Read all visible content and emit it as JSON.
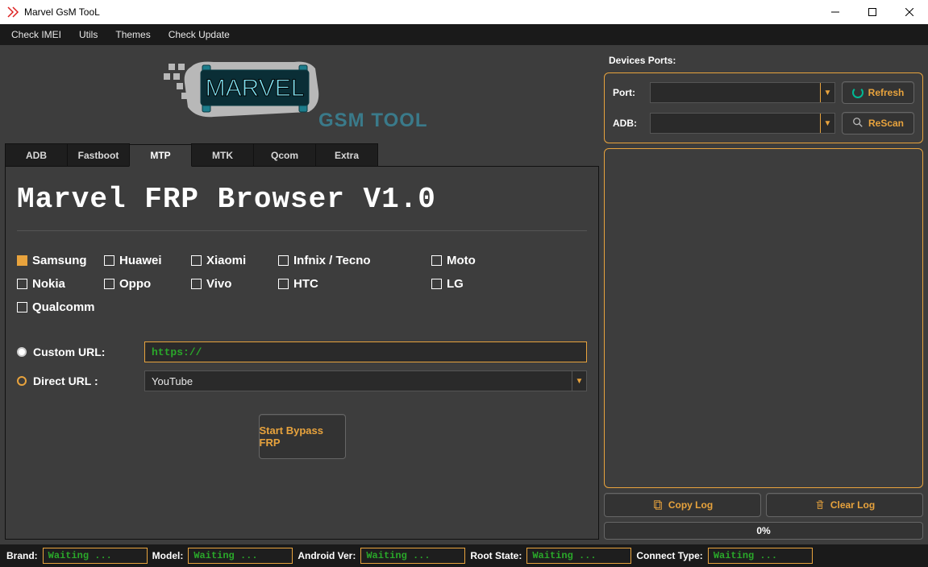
{
  "title": "Marvel GsM TooL",
  "menu": {
    "check_imei": "Check IMEI",
    "utils": "Utils",
    "themes": "Themes",
    "check_update": "Check Update"
  },
  "logo": {
    "text1": "MARVEL",
    "text2": "GSM TOOL"
  },
  "tabs": {
    "adb": "ADB",
    "fastboot": "Fastboot",
    "mtp": "MTP",
    "mtk": "MTK",
    "qcom": "Qcom",
    "extra": "Extra"
  },
  "panel_title": "Marvel FRP Browser V1.0",
  "brands": {
    "samsung": "Samsung",
    "huawei": "Huawei",
    "xiaomi": "Xiaomi",
    "infnix_tecno": "Infnix / Tecno",
    "moto": "Moto",
    "nokia": "Nokia",
    "oppo": "Oppo",
    "vivo": "Vivo",
    "htc": "HTC",
    "lg": "LG",
    "qualcomm": "Qualcomm"
  },
  "url": {
    "custom_label": "Custom URL:",
    "custom_value": "https://",
    "direct_label": "Direct URL :",
    "direct_value": "YouTube"
  },
  "start_button": "Start Bypass FRP",
  "ports": {
    "title": "Devices Ports:",
    "port_label": "Port:",
    "adb_label": "ADB:",
    "refresh": "Refresh",
    "rescan": "ReScan"
  },
  "log": {
    "copy": "Copy Log",
    "clear": "Clear Log"
  },
  "progress": "0%",
  "status": {
    "brand_label": "Brand:",
    "brand_value": "Waiting ...",
    "model_label": "Model:",
    "model_value": "Waiting ...",
    "android_label": "Android Ver:",
    "android_value": "Waiting ...",
    "root_label": "Root State:",
    "root_value": "Waiting ...",
    "connect_label": "Connect Type:",
    "connect_value": "Waiting ..."
  }
}
